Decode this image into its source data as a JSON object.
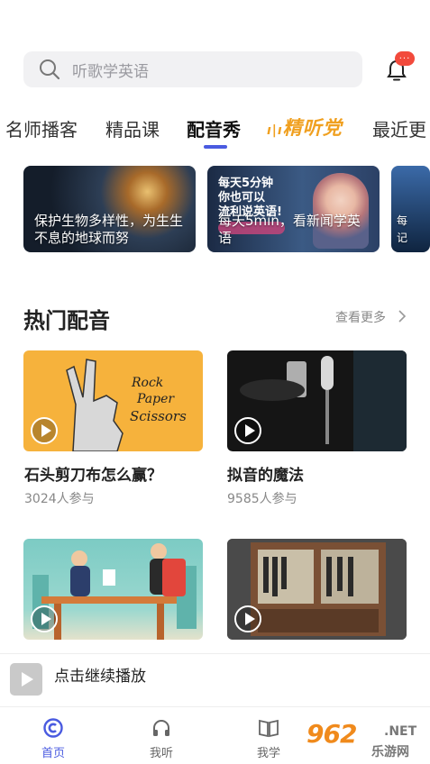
{
  "search": {
    "placeholder": "听歌学英语"
  },
  "notification": {
    "badge": "···"
  },
  "tabs": [
    {
      "label": "名师播客"
    },
    {
      "label": "精品课"
    },
    {
      "label": "配音秀"
    },
    {
      "label": "精听党"
    },
    {
      "label": "最近更"
    }
  ],
  "banners": [
    {
      "caption": "保护生物多样性，为生生不息的地球而努"
    },
    {
      "top_text": "每天5分钟\n你也可以\n流利说英语!",
      "caption": "每天5min，看新闻学英语"
    },
    {
      "caption": "每\n记"
    }
  ],
  "section": {
    "title": "热门配音",
    "more": "查看更多"
  },
  "cards": [
    {
      "title": "石头剪刀布怎么赢？",
      "meta": "3024人参与"
    },
    {
      "title": "拟音的魔法",
      "meta": "9585人参与"
    },
    {
      "title": "",
      "meta": ""
    },
    {
      "title": "",
      "meta": ""
    }
  ],
  "mini_player": {
    "text": "点击继续播放"
  },
  "bottom_nav": [
    {
      "label": "首页",
      "icon": "home-icon",
      "active": true
    },
    {
      "label": "我听",
      "icon": "headphones-icon"
    },
    {
      "label": "我学",
      "icon": "book-icon"
    }
  ],
  "watermark": {
    "brand": "962",
    "domain": ".NET",
    "name": "乐游网"
  },
  "colors": {
    "accent": "#4a5be0",
    "badge": "#f24a3c",
    "special_tab": "#f0a020"
  }
}
